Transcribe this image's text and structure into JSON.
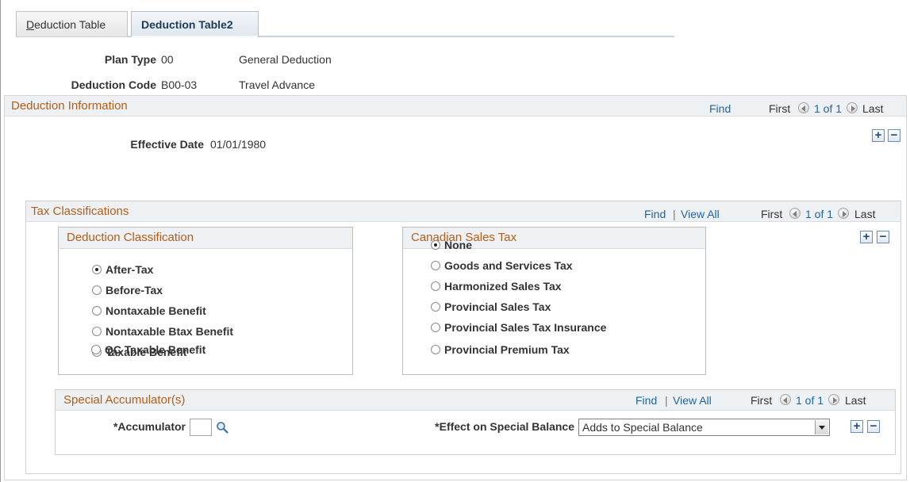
{
  "tabs": [
    {
      "accel": "D",
      "rest": "eduction Table",
      "active": false
    },
    {
      "label": "Deduction Table2",
      "active": true
    }
  ],
  "plan_type": {
    "label": "Plan Type",
    "code": "00",
    "description": "General Deduction"
  },
  "deduction_code": {
    "label": "Deduction Code",
    "code": "B00-03",
    "description": "Travel Advance"
  },
  "deduction_information": {
    "title": "Deduction Information",
    "find": "Find",
    "first": "First",
    "count": "1 of 1",
    "last": "Last",
    "effective_date_label": "Effective Date",
    "effective_date_value": "01/01/1980"
  },
  "tax_classifications": {
    "title": "Tax Classifications",
    "find": "Find",
    "separator": "|",
    "view_all": "View All",
    "first": "First",
    "count": "1 of 1",
    "last": "Last"
  },
  "deduction_classification": {
    "title": "Deduction Classification",
    "selected": 0,
    "options": [
      "After-Tax",
      "Before-Tax",
      "Nontaxable Benefit",
      "Nontaxable Btax Benefit",
      "Taxable Benefit",
      "QC Taxable Benefit"
    ]
  },
  "canadian_sales_tax": {
    "title": "Canadian Sales Tax",
    "selected": 0,
    "options": [
      "None",
      "Goods and Services Tax",
      "Harmonized Sales Tax",
      "Provincial Sales Tax",
      "Provincial Sales Tax Insurance",
      "Provincial Premium Tax"
    ]
  },
  "special_accumulators": {
    "title": "Special Accumulator(s)",
    "find": "Find",
    "separator": "|",
    "view_all": "View All",
    "first": "First",
    "count": "1 of 1",
    "last": "Last",
    "accumulator_label": "*Accumulator",
    "accumulator_value": "",
    "effect_label": "*Effect on Special Balance",
    "effect_value": "Adds to Special Balance"
  },
  "buttons": {
    "add": "+",
    "remove": "−"
  },
  "colors": {
    "section_title": "#b65c17",
    "link": "#1e64a8",
    "header_bg": "#eef1f4"
  }
}
